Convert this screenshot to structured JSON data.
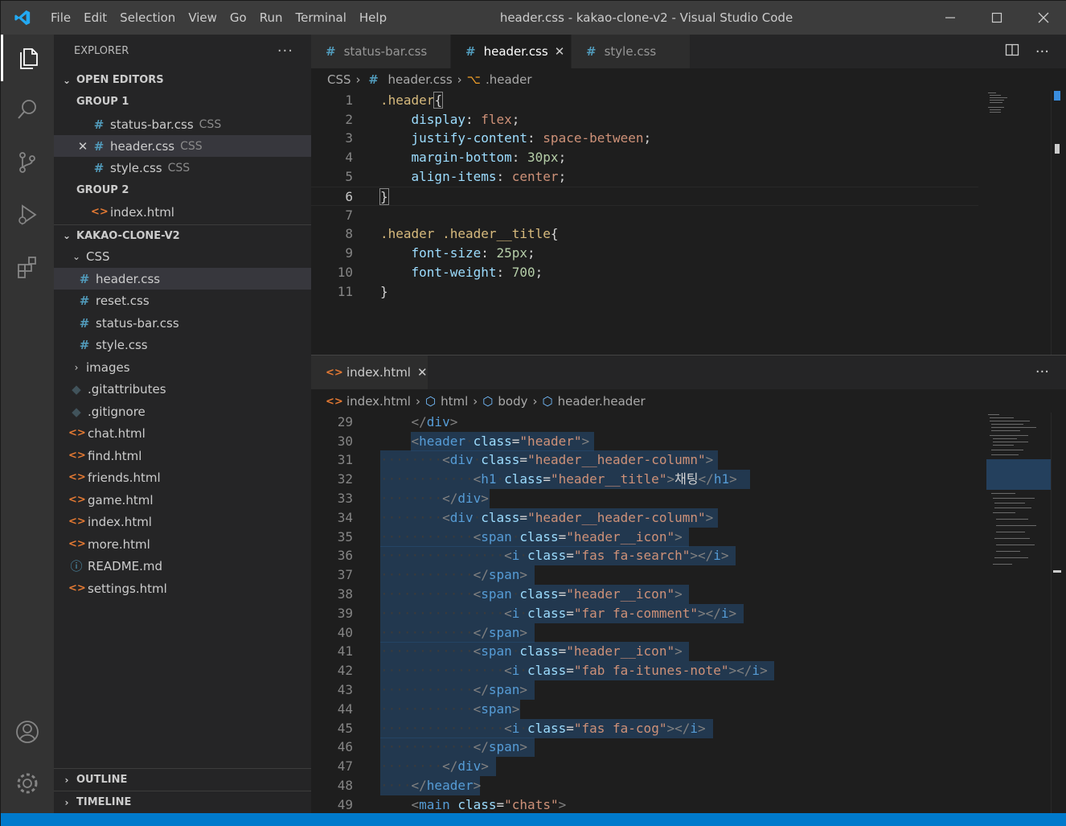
{
  "title": "header.css - kakao-clone-v2 - Visual Studio Code",
  "menu": [
    "File",
    "Edit",
    "Selection",
    "View",
    "Go",
    "Run",
    "Terminal",
    "Help"
  ],
  "sidebar": {
    "title": "EXPLORER",
    "open_editors": "OPEN EDITORS",
    "group1": "GROUP 1",
    "group2": "GROUP 2",
    "oe_files": [
      {
        "name": "status-bar.css",
        "lang": "CSS"
      },
      {
        "name": "header.css",
        "lang": "CSS"
      },
      {
        "name": "style.css",
        "lang": "CSS"
      }
    ],
    "oe_g2": "index.html",
    "project": "KAKAO-CLONE-V2",
    "css_folder": "CSS",
    "css_files": [
      "header.css",
      "reset.css",
      "status-bar.css",
      "style.css"
    ],
    "images": "images",
    "root_files": [
      ".gitattributes",
      ".gitignore",
      "chat.html",
      "find.html",
      "friends.html",
      "game.html",
      "index.html",
      "more.html",
      "README.md",
      "settings.html"
    ],
    "outline": "OUTLINE",
    "timeline": "TIMELINE"
  },
  "tabs": [
    {
      "label": "status-bar.css"
    },
    {
      "label": "header.css"
    },
    {
      "label": "style.css"
    }
  ],
  "breadcrumb1": {
    "a": "CSS",
    "b": "header.css",
    "c": ".header"
  },
  "breadcrumb2": {
    "a": "index.html",
    "b": "html",
    "c": "body",
    "d": "header.header"
  },
  "panel_tab": "index.html",
  "css_lines": [
    "1",
    "2",
    "3",
    "4",
    "5",
    "6",
    "7",
    "8",
    "9",
    "10",
    "11"
  ],
  "html_lines": [
    "29",
    "30",
    "31",
    "32",
    "33",
    "34",
    "35",
    "36",
    "37",
    "38",
    "39",
    "40",
    "41",
    "42",
    "43",
    "44",
    "45",
    "46",
    "47",
    "48",
    "49"
  ]
}
